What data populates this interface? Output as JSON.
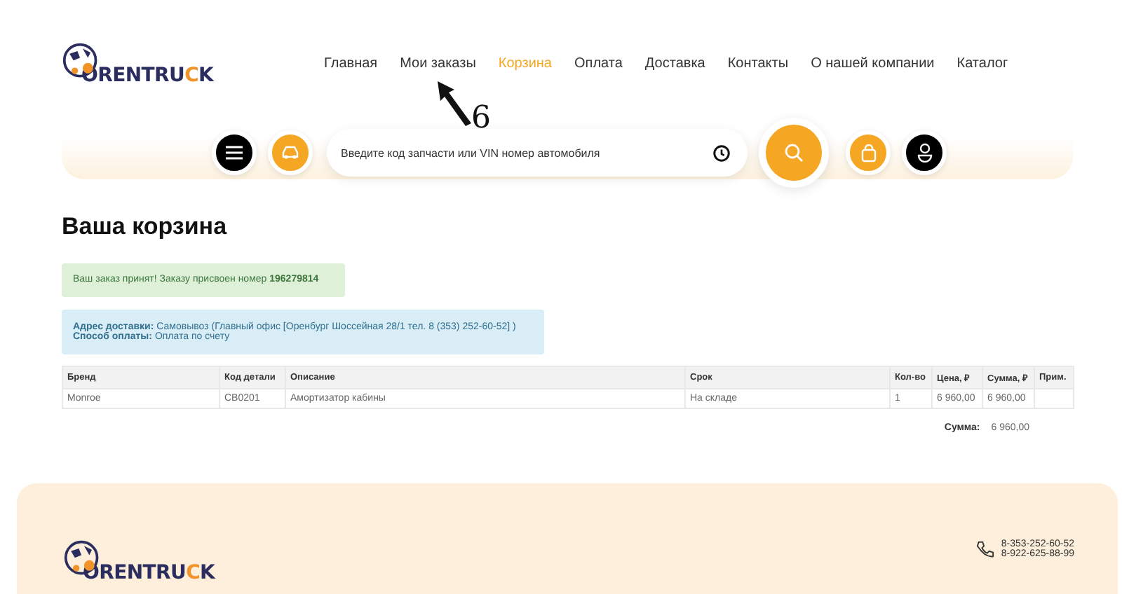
{
  "header": {
    "logo": [
      {
        "kind": "plain",
        "text": "ORENTRU"
      },
      {
        "kind": "accent",
        "text": "C"
      },
      {
        "kind": "plain",
        "text": "K"
      }
    ],
    "nav": [
      {
        "label": "Главная",
        "selected": false
      },
      {
        "label": "Мои заказы",
        "selected": false
      },
      {
        "label": "Корзина",
        "selected": true
      },
      {
        "label": "Оплата",
        "selected": false
      },
      {
        "label": "Доставка",
        "selected": false
      },
      {
        "label": "Контакты",
        "selected": false
      },
      {
        "label": "О нашей компании",
        "selected": false
      },
      {
        "label": "Каталог",
        "selected": false
      }
    ],
    "search": {
      "placeholder": "Введите код запчасти или VIN номер автомобиля"
    }
  },
  "annotation": {
    "label": "6"
  },
  "title": "Ваша корзина",
  "success_alert": "Ваш заказ принят! Заказу присвоен номер **196279814**",
  "info_alert": [
    "**Адрес доставки:** Самовывоз (Главный офис [Оренбург Шоссейная 28/1 тел. 8 (353) 252-60-52] )",
    "**Способ оплаты:** Оплата по счету"
  ],
  "table": {
    "columns": [
      "Бренд",
      "Код детали",
      "Описание",
      "Срок",
      "Кол-во",
      "Цена, ₽",
      "Сумма, ₽",
      "Прим."
    ],
    "rows": [
      [
        "Monroe",
        "CB0201",
        "Амортизатор кабины",
        "На складе",
        "1",
        "6 960,00",
        "6 960,00",
        ""
      ]
    ]
  },
  "total": {
    "label": "Сумма:",
    "value": "6 960,00"
  },
  "footer": {
    "logo": [
      {
        "kind": "plain",
        "text": "ORENTRU"
      },
      {
        "kind": "accent",
        "text": "C"
      },
      {
        "kind": "plain",
        "text": "K"
      }
    ],
    "phones": [
      "8-353-252-60-52",
      "8-922-625-88-99"
    ]
  }
}
